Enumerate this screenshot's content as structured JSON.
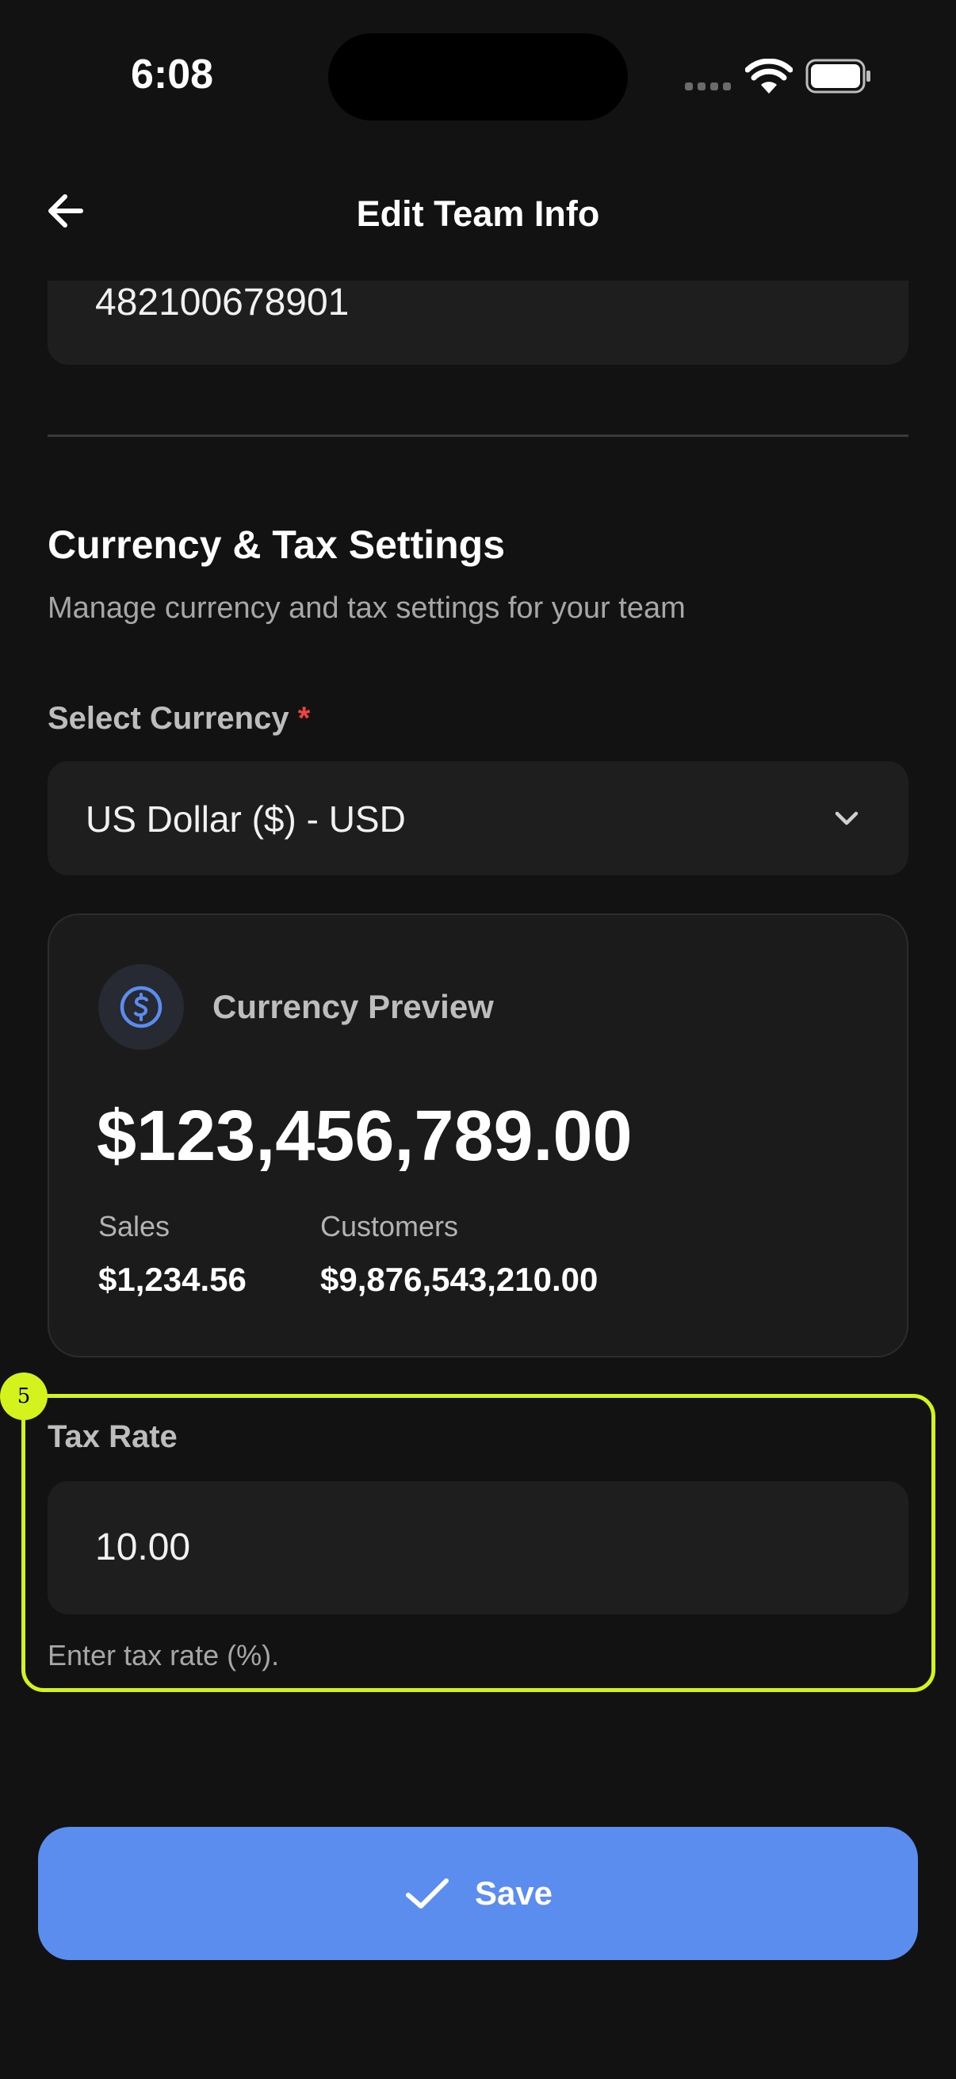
{
  "status_bar": {
    "time": "6:08"
  },
  "header": {
    "title": "Edit Team Info"
  },
  "previous_field": {
    "value": "482100678901"
  },
  "currency_section": {
    "title": "Currency & Tax Settings",
    "subtitle": "Manage currency and tax settings for your team",
    "select_label": "Select Currency",
    "required_mark": "*",
    "selected_currency": "US Dollar ($) - USD"
  },
  "preview": {
    "title": "Currency Preview",
    "amount": "$123,456,789.00",
    "stats": [
      {
        "label": "Sales",
        "value": "$1,234.56"
      },
      {
        "label": "Customers",
        "value": "$9,876,543,210.00"
      }
    ]
  },
  "tax": {
    "badge": "5",
    "label": "Tax Rate",
    "value": "10.00",
    "help": "Enter tax rate (%)."
  },
  "actions": {
    "save_label": "Save"
  },
  "colors": {
    "accent": "#5b8def",
    "highlight": "#d4f21b",
    "required": "#ef4444",
    "background": "#121212"
  }
}
